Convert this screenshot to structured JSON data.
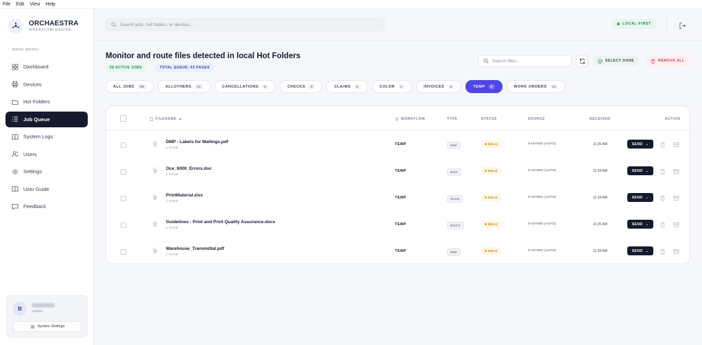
{
  "menubar": [
    "File",
    "Edit",
    "View",
    "Help"
  ],
  "brand": {
    "title": "ORCHAESTRA",
    "subtitle": "WORKFLOW ENGINE"
  },
  "sidebar": {
    "menu_label": "MAIN MENU",
    "items": [
      {
        "label": "Dashboard",
        "icon": "dashboard-icon",
        "active": false
      },
      {
        "label": "Devices",
        "icon": "printer-icon",
        "active": false
      },
      {
        "label": "Hot Folders",
        "icon": "folder-icon",
        "active": false
      },
      {
        "label": "Job Queue",
        "icon": "list-icon",
        "active": true
      },
      {
        "label": "System Logs",
        "icon": "book-icon",
        "active": false
      },
      {
        "label": "Users",
        "icon": "users-icon",
        "active": false
      },
      {
        "label": "Settings",
        "icon": "gear-icon",
        "active": false
      },
      {
        "label": "User Guide",
        "icon": "book-open-icon",
        "active": false
      },
      {
        "label": "Feedback",
        "icon": "chat-icon",
        "active": false
      }
    ],
    "user": {
      "initial": "R",
      "role": "ADMIN",
      "settings_label": "System Settings"
    }
  },
  "header": {
    "search_placeholder": "Search jobs, hot folders, or devices...",
    "status_badge": "LOCAL-FIRST"
  },
  "main": {
    "title": "Monitor and route files detected in local Hot Folders",
    "active_jobs": "58 ACTIVE JOBS",
    "total_queue": "TOTAL QUEUE: 63 PAGES",
    "search_files_placeholder": "Search files...",
    "select_done_label": "SELECT DONE",
    "remove_all_label": "REMOVE ALL",
    "tabs": [
      {
        "label": "ALL JOBS",
        "count": "58",
        "active": false
      },
      {
        "label": "ALLOTHERS",
        "count": "11",
        "active": false
      },
      {
        "label": "CANCELLATIONS",
        "count": "4",
        "active": false
      },
      {
        "label": "CHECKS",
        "count": "8",
        "active": false
      },
      {
        "label": "CLAIMS",
        "count": "2",
        "active": false
      },
      {
        "label": "COLOR",
        "count": "1",
        "active": false
      },
      {
        "label": "INVOICES",
        "count": "4",
        "active": false
      },
      {
        "label": "TEMP",
        "count": "5",
        "active": true
      },
      {
        "label": "WORK ORDERS",
        "count": "11",
        "active": false
      }
    ],
    "table": {
      "columns": [
        "FILENAME",
        "WORKFLOW",
        "TYPE",
        "STATUS",
        "SOURCE",
        "RECEIVED",
        "ACTION"
      ],
      "rows": [
        {
          "filename": "DMP - Labels for Mailings.pdf",
          "pages": "1 PAGE",
          "workflow": "TEMP",
          "type": "PDF",
          "status": "HELD",
          "source": "SYSTEM (AUTO)",
          "received": "11:26 AM",
          "action": "SEND"
        },
        {
          "filename": "Oce_6000_Errors.doc",
          "pages": "1 PAGE",
          "workflow": "TEMP",
          "type": "DOC",
          "status": "HELD",
          "source": "SYSTEM (AUTO)",
          "received": "11:24 AM",
          "action": "SEND"
        },
        {
          "filename": "PrintMaterial.xlsx",
          "pages": "1 PAGE",
          "workflow": "TEMP",
          "type": "XLSX",
          "status": "HELD",
          "source": "SYSTEM (AUTO)",
          "received": "11:24 AM",
          "action": "SEND"
        },
        {
          "filename": "Guidelines - Print and Print Quality Assurance.docx",
          "pages": "1 PAGE",
          "workflow": "TEMP",
          "type": "DOCX",
          "status": "HELD",
          "source": "SYSTEM (AUTO)",
          "received": "11:25 AM",
          "action": "SEND"
        },
        {
          "filename": "Warehouse_Transmittal.pdf",
          "pages": "1 PAGE",
          "workflow": "TEMP",
          "type": "PDF",
          "status": "HELD",
          "source": "SYSTEM (AUTO)",
          "received": "11:25 AM",
          "action": "SEND"
        }
      ]
    }
  },
  "colors": {
    "accent": "#4e46e5",
    "dark": "#151a2d",
    "held": "#f0a21b",
    "success": "#22b46b",
    "danger": "#d2384e"
  }
}
